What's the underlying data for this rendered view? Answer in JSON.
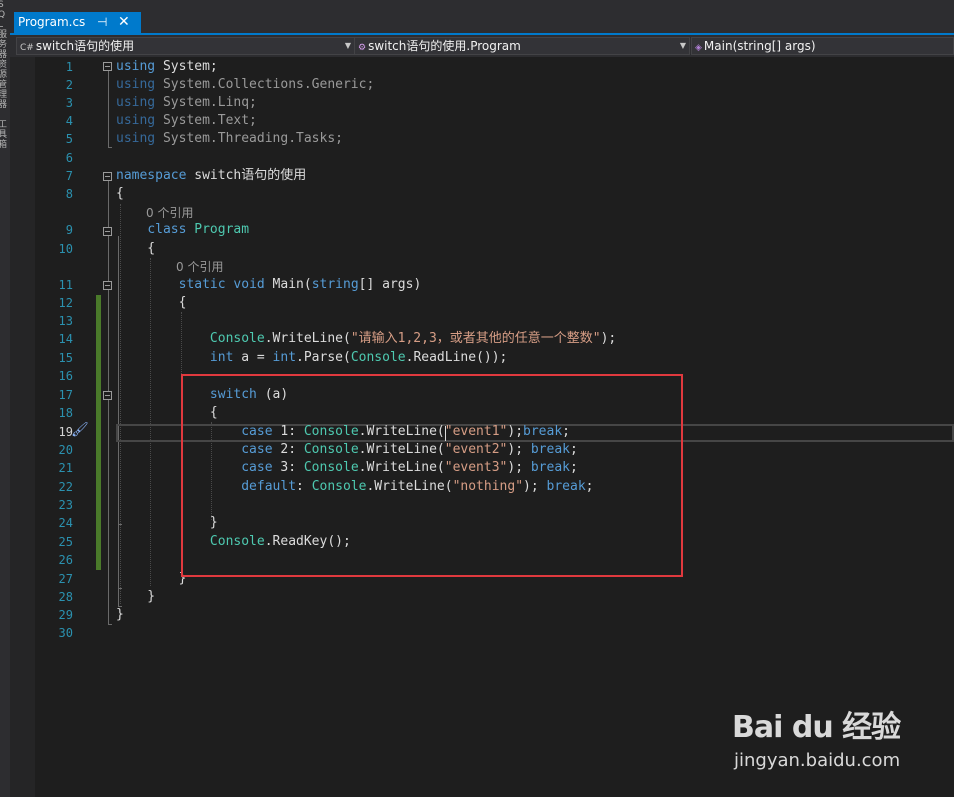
{
  "sidebar": {
    "items": [
      "SQL服务器资源管理器",
      "工具箱"
    ]
  },
  "tab": {
    "label": "Program.cs",
    "pin_glyph": "⊣",
    "close_glyph": "✕"
  },
  "nav": {
    "project": "switch语句的使用",
    "class": "switch语句的使用.Program",
    "member": "Main(string[] args)"
  },
  "codelens": {
    "class_refs": "0 个引用",
    "method_refs": "0 个引用"
  },
  "editor": {
    "line_numbers": [
      "1",
      "2",
      "3",
      "4",
      "5",
      "6",
      "7",
      "8",
      "9",
      "10",
      "11",
      "12",
      "13",
      "14",
      "15",
      "16",
      "17",
      "18",
      "19",
      "20",
      "21",
      "22",
      "23",
      "24",
      "25",
      "26",
      "27",
      "28",
      "29",
      "30"
    ],
    "current_line": "19"
  },
  "watermark": {
    "logo": "Bai du 经验",
    "url": "jingyan.baidu.com"
  },
  "colors": {
    "accent": "#007acc",
    "keyword": "#569cd6",
    "type": "#4ec9b0",
    "string": "#d69d85",
    "line_number": "#2b91af",
    "highlight_box": "#e0393e"
  }
}
